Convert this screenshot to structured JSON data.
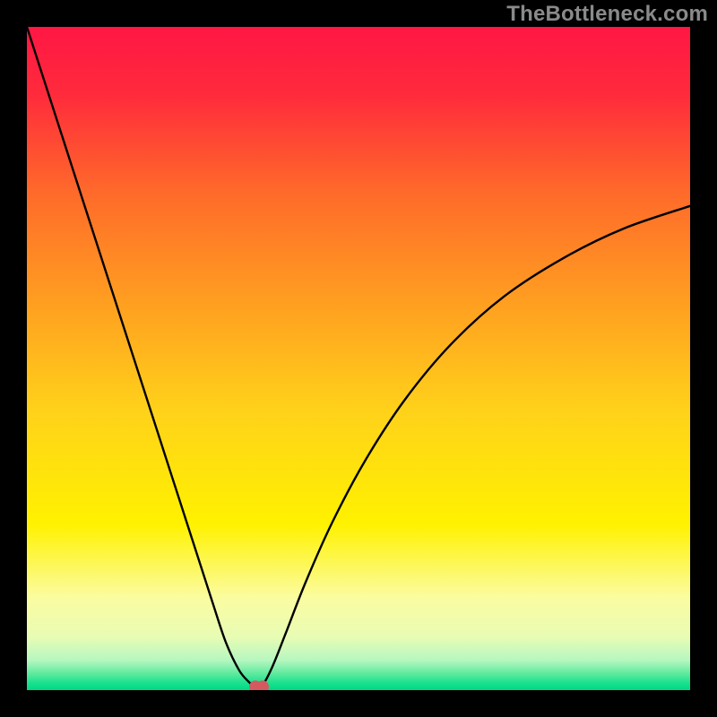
{
  "watermark": "TheBottleneck.com",
  "chart_data": {
    "type": "line",
    "title": "",
    "xlabel": "",
    "ylabel": "",
    "xlim": [
      0,
      100
    ],
    "ylim": [
      0,
      100
    ],
    "grid": false,
    "background_gradient": {
      "stops": [
        {
          "offset": 0.0,
          "color": "#ff1744"
        },
        {
          "offset": 0.1,
          "color": "#ff2a3c"
        },
        {
          "offset": 0.25,
          "color": "#ff6a2a"
        },
        {
          "offset": 0.42,
          "color": "#ffa020"
        },
        {
          "offset": 0.58,
          "color": "#ffd21a"
        },
        {
          "offset": 0.75,
          "color": "#fff200"
        },
        {
          "offset": 0.86,
          "color": "#fbfca0"
        },
        {
          "offset": 0.92,
          "color": "#e8fcb4"
        },
        {
          "offset": 0.955,
          "color": "#b6f7c0"
        },
        {
          "offset": 0.975,
          "color": "#5eea9e"
        },
        {
          "offset": 0.99,
          "color": "#17e08e"
        },
        {
          "offset": 1.0,
          "color": "#00d985"
        }
      ]
    },
    "series": [
      {
        "name": "bottleneck-curve",
        "color": "#000000",
        "stroke_width": 2.4,
        "x": [
          0,
          5,
          10,
          15,
          20,
          25,
          28,
          30,
          32,
          33.5,
          34.5,
          35.5,
          37,
          39,
          42,
          46,
          51,
          57,
          64,
          72,
          81,
          90,
          100
        ],
        "values": [
          100,
          84.5,
          69.0,
          53.5,
          38.0,
          22.5,
          13.2,
          7.2,
          3.0,
          1.2,
          0.4,
          0.7,
          3.5,
          8.5,
          16.2,
          25.2,
          34.6,
          43.8,
          52.2,
          59.4,
          65.2,
          69.6,
          73.0
        ]
      }
    ],
    "marker": {
      "name": "min-point-marker",
      "x": 35.0,
      "y": 0.5,
      "color": "#d35a5f",
      "radius_px": 7
    }
  }
}
